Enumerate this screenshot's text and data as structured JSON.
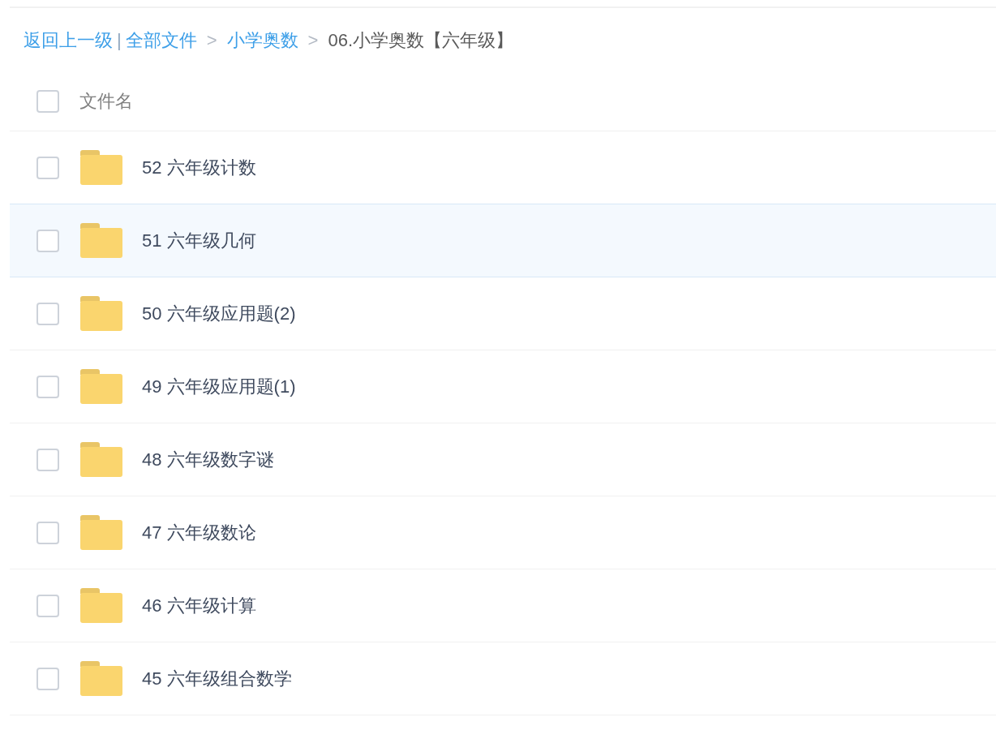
{
  "breadcrumb": [
    {
      "kind": "back",
      "label": "返回上一级"
    },
    {
      "kind": "divider",
      "label": "|"
    },
    {
      "kind": "link",
      "label": "全部文件"
    },
    {
      "kind": "separator",
      "label": ">"
    },
    {
      "kind": "link",
      "label": "小学奥数"
    },
    {
      "kind": "separator",
      "label": ">"
    },
    {
      "kind": "current",
      "label": "06.小学奥数【六年级】"
    }
  ],
  "header": {
    "select_all": {
      "checked": false
    },
    "column": "文件名"
  },
  "rows": [
    {
      "name": "52 六年级计数",
      "checked": false,
      "hovered": false
    },
    {
      "name": "51 六年级几何",
      "checked": false,
      "hovered": true
    },
    {
      "name": "50 六年级应用题(2)",
      "checked": false,
      "hovered": false
    },
    {
      "name": "49 六年级应用题(1)",
      "checked": false,
      "hovered": false
    },
    {
      "name": "48 六年级数字谜",
      "checked": false,
      "hovered": false
    },
    {
      "name": "47 六年级数论",
      "checked": false,
      "hovered": false
    },
    {
      "name": "46 六年级计算",
      "checked": false,
      "hovered": false
    },
    {
      "name": "45 六年级组合数学",
      "checked": false,
      "hovered": false
    }
  ]
}
